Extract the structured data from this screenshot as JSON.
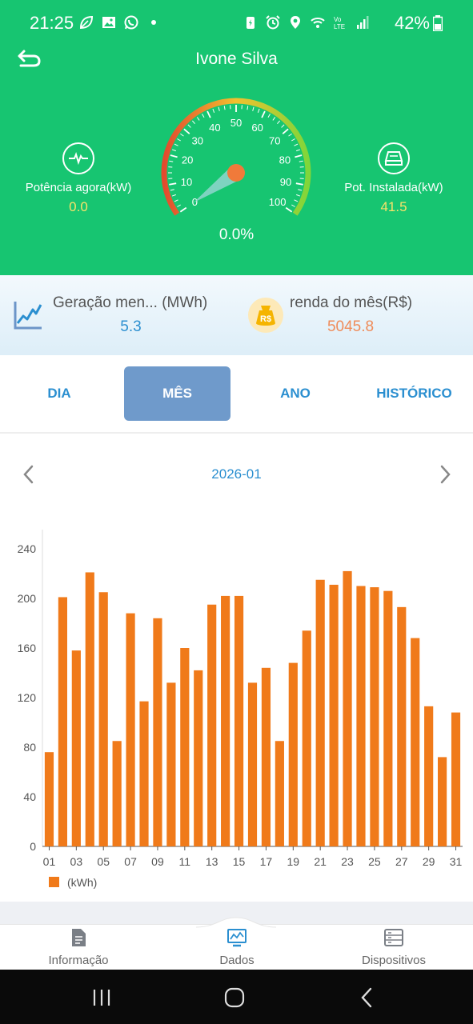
{
  "status_bar": {
    "time": "21:25",
    "battery": "42%"
  },
  "header": {
    "title": "Ivone Silva",
    "power_now_label": "Potência agora(kW)",
    "power_now_value": "0.0",
    "installed_label": "Pot. Instalada(kW)",
    "installed_value": "41.5",
    "gauge_ticks": [
      "0",
      "10",
      "20",
      "30",
      "40",
      "50",
      "60",
      "70",
      "80",
      "90",
      "100"
    ],
    "gauge_percent": "0.0%",
    "gauge_level": 0.0
  },
  "summary": {
    "generation_label": "Geração men... (MWh)",
    "generation_value": "5.3",
    "income_label": "renda do mês(R$)",
    "income_value": "5045.8",
    "coin_text": "R$"
  },
  "tabs": [
    {
      "label": "DIA",
      "active": false
    },
    {
      "label": "MÊS",
      "active": true
    },
    {
      "label": "ANO",
      "active": false
    },
    {
      "label": "HISTÓRICO",
      "active": false
    }
  ],
  "date_nav": {
    "current": "2026-01"
  },
  "chart_data": {
    "type": "bar",
    "categories": [
      "01",
      "02",
      "03",
      "04",
      "05",
      "06",
      "07",
      "08",
      "09",
      "10",
      "11",
      "12",
      "13",
      "14",
      "15",
      "16",
      "17",
      "18",
      "19",
      "20",
      "21",
      "22",
      "23",
      "24",
      "25",
      "26",
      "27",
      "28",
      "29",
      "30",
      "31"
    ],
    "x_tick_labels": [
      "01",
      "03",
      "05",
      "07",
      "09",
      "11",
      "13",
      "15",
      "17",
      "19",
      "21",
      "23",
      "25",
      "27",
      "29",
      "31"
    ],
    "series": [
      {
        "name": "(kWh)",
        "values": [
          76,
          201,
          158,
          221,
          205,
          85,
          188,
          117,
          184,
          132,
          160,
          142,
          195,
          202,
          202,
          132,
          144,
          85,
          148,
          174,
          215,
          211,
          222,
          210,
          209,
          206,
          193,
          168,
          113,
          72,
          108
        ]
      }
    ],
    "y_ticks": [
      "0",
      "40",
      "80",
      "120",
      "160",
      "200",
      "240"
    ],
    "ylim": [
      0,
      240
    ],
    "color": "#f07a1a",
    "legend": "bottom-left",
    "grid": false
  },
  "bottom_nav": [
    {
      "label": "Informação",
      "icon": "document-icon",
      "active": false
    },
    {
      "label": "Dados",
      "icon": "monitor-chart-icon",
      "active": true
    },
    {
      "label": "Dispositivos",
      "icon": "device-rack-icon",
      "active": false
    }
  ],
  "colors": {
    "header_green": "#17c571",
    "accent_blue": "#2b8fd0",
    "active_tab": "#6f9acb",
    "bar_orange": "#f07a1a",
    "value_yellow": "#f7e36a",
    "income_orange": "#ef8c5a"
  }
}
